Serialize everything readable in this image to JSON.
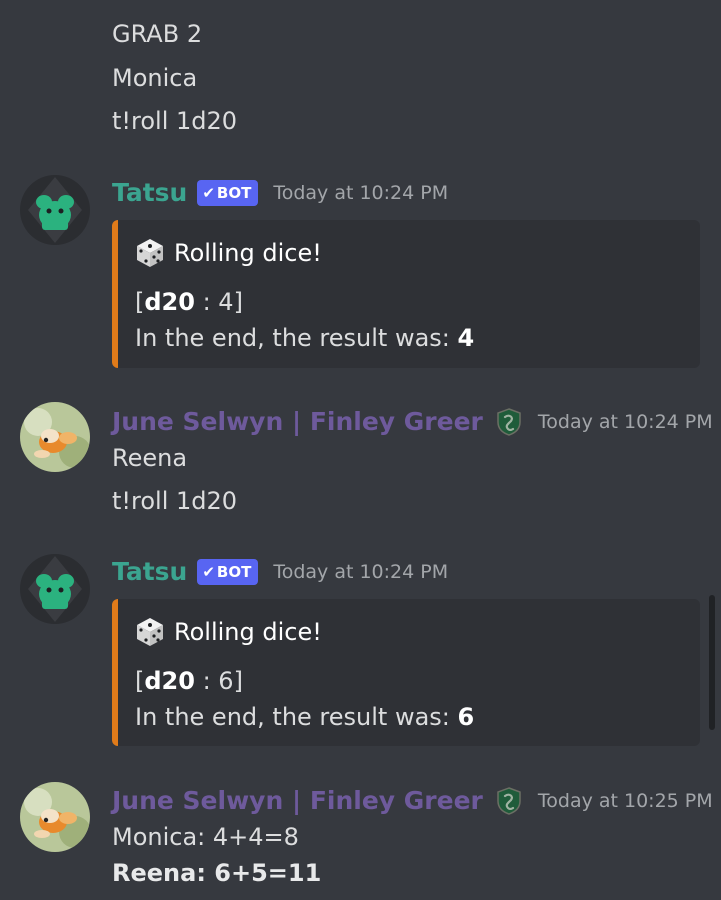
{
  "colors": {
    "background": "#36393f",
    "embed_background": "#2f3136",
    "embed_border": "#e07b1a",
    "bot_name": "#3ba590",
    "user_name": "#6e5a9c",
    "bot_tag": "#5865f2",
    "timestamp": "#a3a6aa",
    "text": "#dcddde"
  },
  "top_messages": [
    "GRAB 2",
    "Monica",
    "t!roll 1d20"
  ],
  "msg1": {
    "author": "Tatsu",
    "bot_tag": "BOT",
    "timestamp": "Today at 10:24 PM",
    "avatar_icon": "tatsu-avatar-icon",
    "embed": {
      "title": "Rolling dice!",
      "title_icon": "dice-icon",
      "roll_open": "[",
      "roll_die": "d20",
      "roll_value": " : 4]",
      "result_label": "In the end, the result was: ",
      "result_value": "4"
    }
  },
  "msg2": {
    "author": "June Selwyn | Finley Greer",
    "role_icon": "slytherin-badge-icon",
    "timestamp": "Today at 10:24 PM",
    "avatar_icon": "goldfish-avatar-icon",
    "lines": [
      "Reena",
      "t!roll 1d20"
    ]
  },
  "msg3": {
    "author": "Tatsu",
    "bot_tag": "BOT",
    "timestamp": "Today at 10:24 PM",
    "avatar_icon": "tatsu-avatar-icon",
    "embed": {
      "title": "Rolling dice!",
      "title_icon": "dice-icon",
      "roll_open": "[",
      "roll_die": "d20",
      "roll_value": " : 6]",
      "result_label": "In the end, the result was: ",
      "result_value": "6"
    }
  },
  "msg4": {
    "author": "June Selwyn | Finley Greer",
    "role_icon": "slytherin-badge-icon",
    "timestamp": "Today at 10:25 PM",
    "avatar_icon": "goldfish-avatar-icon",
    "lines": [
      "Monica: 4+4=8",
      "Reena: 6+5=11"
    ]
  }
}
